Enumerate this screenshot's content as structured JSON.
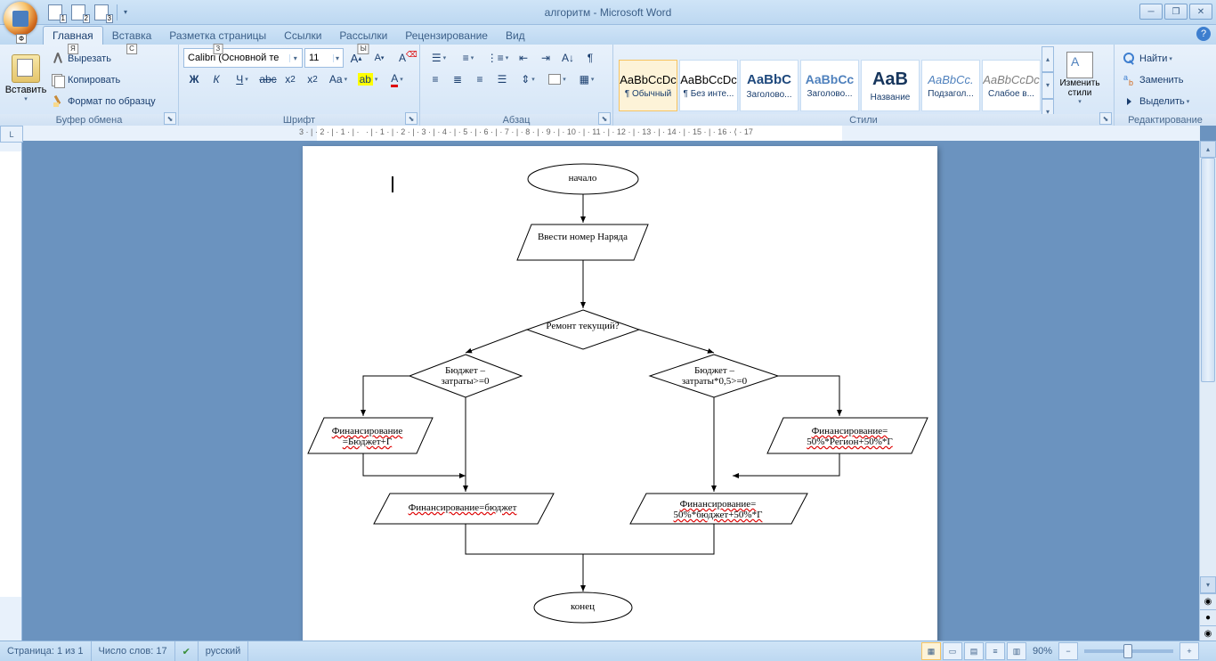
{
  "title": "алгоритм - Microsoft Word",
  "qat_hints": [
    "1",
    "2",
    "3"
  ],
  "qat_under": "Ф",
  "tabs": [
    {
      "label": "Главная",
      "hint": "Я",
      "active": true
    },
    {
      "label": "Вставка",
      "hint": "С"
    },
    {
      "label": "Разметка страницы",
      "hint": "З"
    },
    {
      "label": "Ссылки",
      "hint": ""
    },
    {
      "label": "Рассылки",
      "hint": "Ы"
    },
    {
      "label": "Рецензирование",
      "hint": ""
    },
    {
      "label": "Вид",
      "hint": ""
    }
  ],
  "ribbon": {
    "clipboard": {
      "label": "Буфер обмена",
      "paste": "Вставить",
      "cut": "Вырезать",
      "copy": "Копировать",
      "format": "Формат по образцу"
    },
    "font": {
      "label": "Шрифт",
      "name": "Calibri (Основной те",
      "size": "11"
    },
    "para": {
      "label": "Абзац"
    },
    "styles": {
      "label": "Стили",
      "items": [
        {
          "prev": "AaBbCcDc",
          "name": "¶ Обычный",
          "sel": true,
          "color": "#000"
        },
        {
          "prev": "AaBbCcDc",
          "name": "¶ Без инте...",
          "color": "#000"
        },
        {
          "prev": "AaBbC",
          "name": "Заголово...",
          "color": "#1f497d",
          "size": "15px",
          "bold": true
        },
        {
          "prev": "AaBbCc",
          "name": "Заголово...",
          "color": "#4f81bd",
          "size": "14px",
          "bold": true
        },
        {
          "prev": "AaB",
          "name": "Название",
          "color": "#17365d",
          "size": "20px",
          "bold": true
        },
        {
          "prev": "AaBbCc.",
          "name": "Подзагол...",
          "color": "#4f81bd",
          "italic": true
        },
        {
          "prev": "AaBbCcDc",
          "name": "Слабое в...",
          "color": "#808080",
          "italic": true
        }
      ],
      "change": "Изменить стили"
    },
    "edit": {
      "label": "Редактирование",
      "find": "Найти",
      "replace": "Заменить",
      "select": "Выделить"
    }
  },
  "flowchart": {
    "start": "начало",
    "input": "Ввести номер Наряда",
    "decision1": "Ремонт текущий?",
    "decision_left": "Бюджет – затраты>=0",
    "decision_right": "Бюджет – затраты*0,5>=0",
    "proc_lt": "Финансирование =Бюджет+Г",
    "proc_lb": "Финансирование=бюджет",
    "proc_rt": "Финансирование= 50%*Регион+50%*Г",
    "proc_rb": "Финансирование= 50%*бюджет+50%*Г",
    "end": "конец"
  },
  "status": {
    "page": "Страница: 1 из 1",
    "words": "Число слов: 17",
    "lang": "русский",
    "zoom": "90%"
  }
}
